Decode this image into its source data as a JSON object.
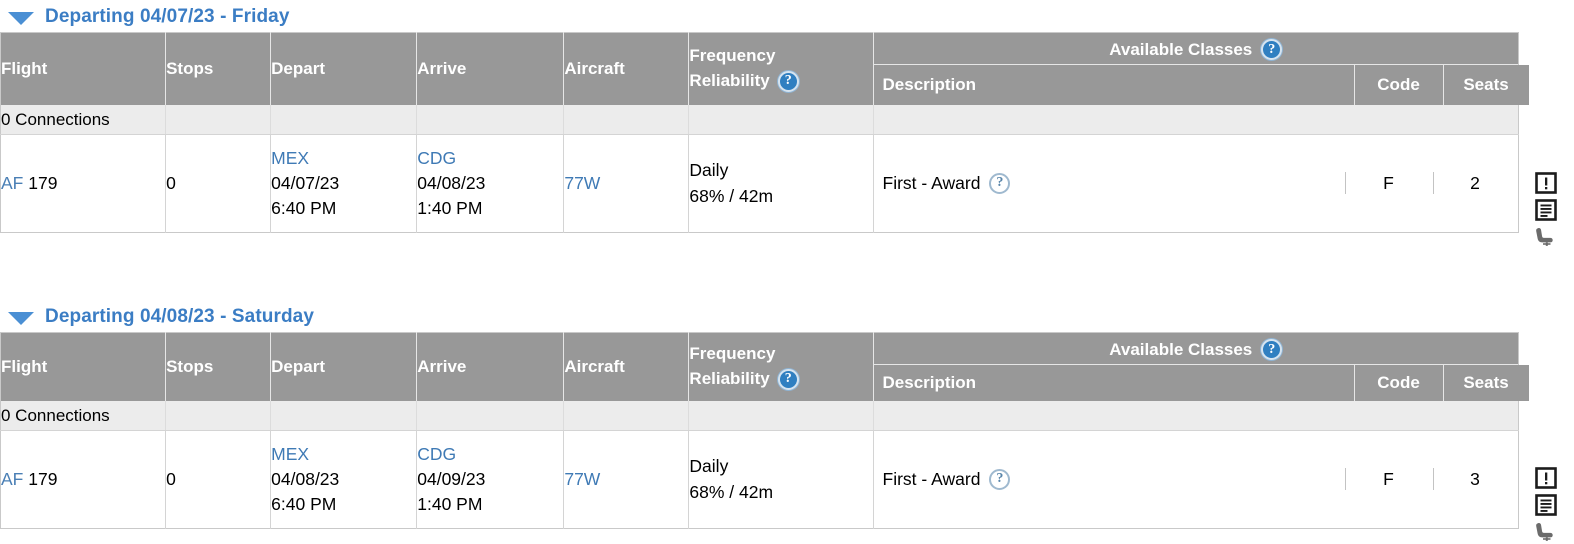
{
  "columns": {
    "flight": "Flight",
    "stops": "Stops",
    "depart": "Depart",
    "arrive": "Arrive",
    "aircraft": "Aircraft",
    "frequency": "Frequency",
    "reliability": "Reliability",
    "available_classes": "Available Classes",
    "description": "Description",
    "code": "Code",
    "seats": "Seats"
  },
  "icons": {
    "help": "?",
    "disclosure": "triangle-down",
    "alert": "alert-icon",
    "details": "details-icon",
    "seatmap": "seat-icon"
  },
  "sections": [
    {
      "title": "Departing 04/07/23 - Friday",
      "connections_label": "0 Connections",
      "rows": [
        {
          "carrier": "AF",
          "flight_number": "179",
          "stops": "0",
          "depart_airport": "MEX",
          "depart_date": "04/07/23",
          "depart_time": "6:40 PM",
          "arrive_airport": "CDG",
          "arrive_date": "04/08/23",
          "arrive_time": "1:40 PM",
          "aircraft": "77W",
          "frequency": "Daily",
          "reliability": "68% / 42m",
          "class_description": "First - Award",
          "class_code": "F",
          "class_seats": "2"
        }
      ]
    },
    {
      "title": "Departing 04/08/23 - Saturday",
      "connections_label": "0 Connections",
      "rows": [
        {
          "carrier": "AF",
          "flight_number": "179",
          "stops": "0",
          "depart_airport": "MEX",
          "depart_date": "04/08/23",
          "depart_time": "6:40 PM",
          "arrive_airport": "CDG",
          "arrive_date": "04/09/23",
          "arrive_time": "1:40 PM",
          "aircraft": "77W",
          "frequency": "Daily",
          "reliability": "68% / 42m",
          "class_description": "First - Award",
          "class_code": "F",
          "class_seats": "3"
        }
      ]
    }
  ],
  "colors": {
    "header_gray": "#989898",
    "link_blue": "#4a7fb5",
    "title_blue": "#3b7dc4",
    "connections_gray": "#ececec"
  }
}
